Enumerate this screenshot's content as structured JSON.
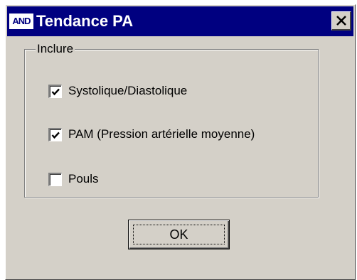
{
  "window": {
    "title": "Tendance PA",
    "app_logo_text": "AND",
    "close_icon": "close-icon",
    "titlebar_color": "#000080",
    "face_color": "#d4d0c8"
  },
  "group": {
    "label": "Inclure",
    "options": [
      {
        "label": "Systolique/Diastolique",
        "checked": true
      },
      {
        "label": "PAM (Pression artérielle moyenne)",
        "checked": true
      },
      {
        "label": "Pouls",
        "checked": false
      }
    ]
  },
  "ok_button": {
    "label": "OK",
    "mnemonic": "O"
  }
}
